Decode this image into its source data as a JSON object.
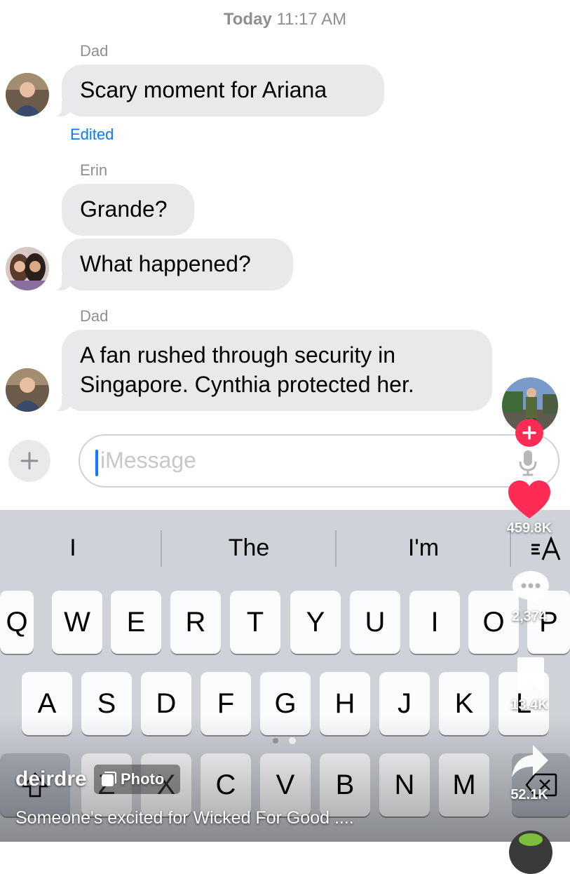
{
  "messages": {
    "timestamp_day": "Today",
    "timestamp_time": "11:17 AM",
    "groups": [
      {
        "sender": "Dad",
        "bubbles": [
          "Scary moment for Ariana"
        ],
        "status": "Edited"
      },
      {
        "sender": "Erin",
        "bubbles": [
          "Grande?",
          "What happened?"
        ]
      },
      {
        "sender": "Dad",
        "bubbles": [
          "A fan rushed through security in Singapore. Cynthia protected her."
        ]
      }
    ]
  },
  "composer": {
    "placeholder": "iMessage",
    "plus_icon": "plus-icon",
    "mic_icon": "microphone-icon"
  },
  "keyboard": {
    "suggestions": [
      "I",
      "The",
      "I'm"
    ],
    "format_icon": "text-format-icon",
    "row1": [
      "Q",
      "W",
      "E",
      "R",
      "T",
      "Y",
      "U",
      "I",
      "O",
      "P"
    ],
    "row2": [
      "A",
      "S",
      "D",
      "F",
      "G",
      "H",
      "J",
      "K",
      "L"
    ],
    "row3": [
      "Z",
      "X",
      "C",
      "V",
      "B",
      "N",
      "M"
    ],
    "page_dots": 2,
    "active_page": 2
  },
  "overlay": {
    "likes": "459.8K",
    "comments": "2,374",
    "saves": "13.4K",
    "shares": "52.1K",
    "username": "deirdre",
    "post_type": "Photo",
    "caption": "Someone's excited for Wicked For Good ....",
    "accent_color": "#fe2c55"
  }
}
